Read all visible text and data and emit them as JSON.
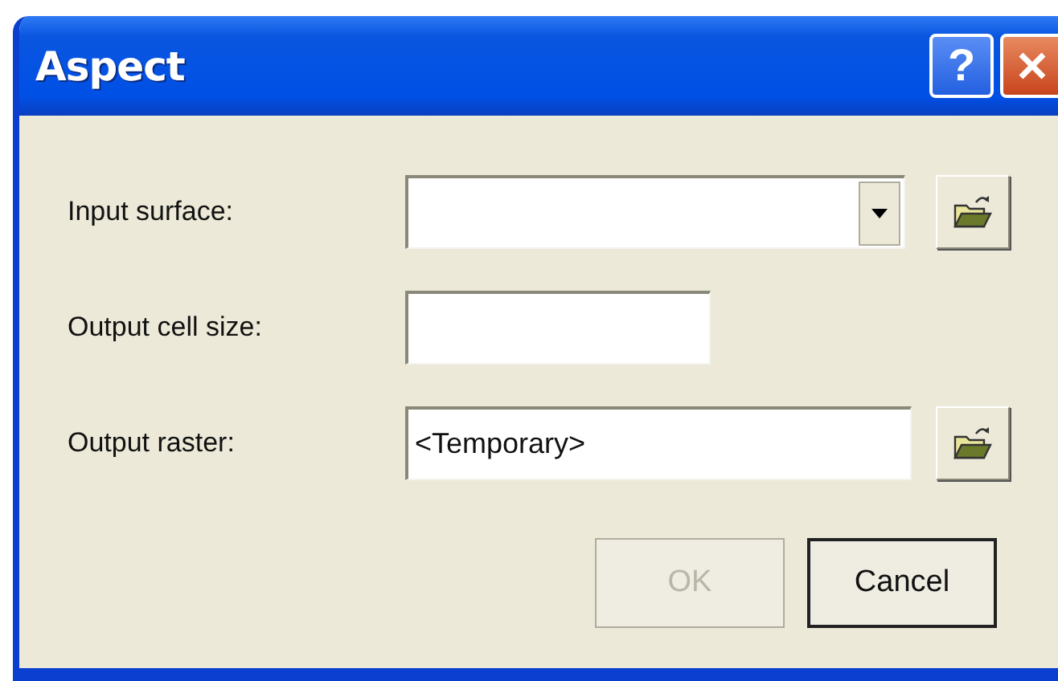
{
  "window": {
    "title": "Aspect"
  },
  "title_buttons": [
    {
      "kind": "help",
      "label": "?"
    },
    {
      "kind": "close"
    }
  ],
  "fields": [
    {
      "label": "Input surface:",
      "kind": "combo",
      "browse": true
    },
    {
      "label": "Output cell size:",
      "kind": "number",
      "browse": false
    },
    {
      "label": "Output raster:",
      "kind": "text",
      "value": "<Temporary>",
      "browse": true
    }
  ],
  "buttons": [
    {
      "label": "OK",
      "disabled": true
    },
    {
      "label": "Cancel",
      "disabled": false
    }
  ]
}
